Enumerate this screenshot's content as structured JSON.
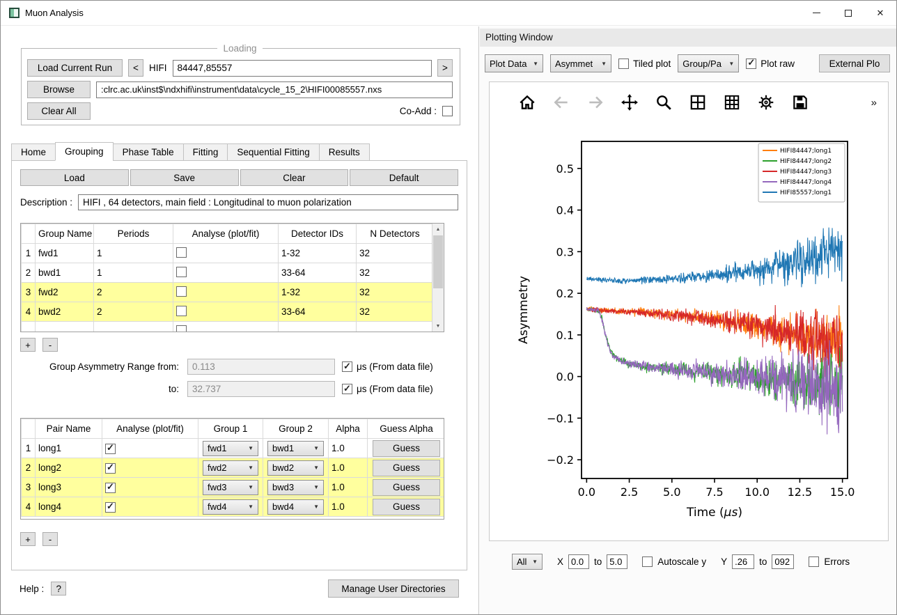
{
  "window": {
    "title": "Muon Analysis",
    "minimize": "",
    "maximize": "",
    "close": "✕"
  },
  "loading": {
    "group_title": "Loading",
    "load_current_run": "Load Current Run",
    "prev_run": "<",
    "next_run": ">",
    "instrument_label": "HIFI",
    "runs_value": "84447,85557",
    "browse": "Browse",
    "file_path": ":clrc.ac.uk\\inst$\\ndxhifi\\instrument\\data\\cycle_15_2\\HIFI00085557.nxs",
    "clear_all": "Clear All",
    "co_add_label": "Co-Add :",
    "co_add_checked": false
  },
  "tabs": [
    {
      "label": "Home"
    },
    {
      "label": "Grouping"
    },
    {
      "label": "Phase Table"
    },
    {
      "label": "Fitting"
    },
    {
      "label": "Sequential Fitting"
    },
    {
      "label": "Results"
    }
  ],
  "active_tab": "Grouping",
  "grouping": {
    "load": "Load",
    "save": "Save",
    "clear": "Clear",
    "default": "Default",
    "description_label": "Description :",
    "description_value": "HIFI , 64 detectors, main field : Longitudinal to muon polarization",
    "group_table": {
      "headers": {
        "name": "Group Name",
        "periods": "Periods",
        "analyse": "Analyse (plot/fit)",
        "detector_ids": "Detector IDs",
        "n_detectors": "N Detectors"
      },
      "rows": [
        {
          "num": "1",
          "name": "fwd1",
          "periods": "1",
          "analyse": false,
          "detector_ids": "1-32",
          "n_detectors": "32",
          "highlight": false
        },
        {
          "num": "2",
          "name": "bwd1",
          "periods": "1",
          "analyse": false,
          "detector_ids": "33-64",
          "n_detectors": "32",
          "highlight": false
        },
        {
          "num": "3",
          "name": "fwd2",
          "periods": "2",
          "analyse": false,
          "detector_ids": "1-32",
          "n_detectors": "32",
          "highlight": true
        },
        {
          "num": "4",
          "name": "bwd2",
          "periods": "2",
          "analyse": false,
          "detector_ids": "33-64",
          "n_detectors": "32",
          "highlight": true
        },
        {
          "num": "",
          "name": "",
          "periods": "",
          "analyse": false,
          "detector_ids": "",
          "n_detectors": "",
          "highlight": false
        }
      ]
    },
    "add_button": "+",
    "remove_button": "-",
    "range": {
      "from_label": "Group Asymmetry Range from:",
      "from_value": "0.113",
      "to_label": "to:",
      "to_value": "32.737",
      "unit_label": "μs (From data file)",
      "from_checked": true,
      "to_checked": true
    },
    "pair_table": {
      "headers": {
        "name": "Pair Name",
        "analyse": "Analyse (plot/fit)",
        "group1": "Group 1",
        "group2": "Group 2",
        "alpha": "Alpha",
        "guess": "Guess Alpha"
      },
      "rows": [
        {
          "num": "1",
          "name": "long1",
          "analyse": true,
          "group1": "fwd1",
          "group2": "bwd1",
          "alpha": "1.0",
          "guess": "Guess",
          "highlight": false
        },
        {
          "num": "2",
          "name": "long2",
          "analyse": true,
          "group1": "fwd2",
          "group2": "bwd2",
          "alpha": "1.0",
          "guess": "Guess",
          "highlight": true
        },
        {
          "num": "3",
          "name": "long3",
          "analyse": true,
          "group1": "fwd3",
          "group2": "bwd3",
          "alpha": "1.0",
          "guess": "Guess",
          "highlight": true
        },
        {
          "num": "4",
          "name": "long4",
          "analyse": true,
          "group1": "fwd4",
          "group2": "bwd4",
          "alpha": "1.0",
          "guess": "Guess",
          "highlight": true
        }
      ]
    },
    "help_label": "Help :",
    "help_button": "?",
    "manage_dirs": "Manage User Directories"
  },
  "plotting": {
    "title": "Plotting Window",
    "toolbar": {
      "plot_data": "Plot Data",
      "plot_type": "Asymmet",
      "tiled_plot": "Tiled plot",
      "tiled_checked": false,
      "group_pair": "Group/Pa",
      "plot_raw": "Plot raw",
      "plot_raw_checked": true,
      "external_plot": "External Plo",
      "overflow": "»"
    },
    "controls": {
      "scope": "All",
      "x_label": "X",
      "x_from": "0.0",
      "to_label": "to",
      "x_to": "5.0",
      "autoscale_label": "Autoscale y",
      "autoscale_checked": false,
      "y_label": "Y",
      "y_from": ".26",
      "y_to": "092",
      "errors_label": "Errors",
      "errors_checked": false
    }
  },
  "chart_data": {
    "type": "line",
    "title": "",
    "xlabel": "Time (μs)",
    "ylabel": "Asymmetry",
    "xlim": [
      -0.3,
      15.3
    ],
    "ylim": [
      -0.245,
      0.565
    ],
    "xticks": [
      0.0,
      2.5,
      5.0,
      7.5,
      10.0,
      12.5,
      15.0
    ],
    "yticks": [
      -0.2,
      -0.1,
      0.0,
      0.1,
      0.2,
      0.3,
      0.4,
      0.5
    ],
    "grid": false,
    "legend_position": "upper right",
    "series": [
      {
        "name": "HIFI84447;long1",
        "color": "#ff7f0e",
        "trend": [
          [
            0,
            0.163
          ],
          [
            1,
            0.16
          ],
          [
            2,
            0.157
          ],
          [
            3,
            0.155
          ],
          [
            4,
            0.152
          ],
          [
            5,
            0.149
          ],
          [
            6,
            0.146
          ],
          [
            7,
            0.141
          ],
          [
            8,
            0.135
          ],
          [
            9,
            0.128
          ],
          [
            10,
            0.12
          ],
          [
            11,
            0.112
          ],
          [
            12,
            0.104
          ],
          [
            13,
            0.096
          ],
          [
            14,
            0.088
          ],
          [
            15,
            0.08
          ]
        ],
        "noise": [
          [
            0,
            0.004
          ],
          [
            4,
            0.008
          ],
          [
            8,
            0.016
          ],
          [
            10,
            0.024
          ],
          [
            12,
            0.038
          ],
          [
            15,
            0.06
          ]
        ]
      },
      {
        "name": "HIFI84447;long2",
        "color": "#2ca02c",
        "trend": [
          [
            0,
            0.162
          ],
          [
            0.7,
            0.158
          ],
          [
            0.9,
            0.14
          ],
          [
            1.1,
            0.1
          ],
          [
            1.4,
            0.062
          ],
          [
            1.8,
            0.042
          ],
          [
            2.5,
            0.03
          ],
          [
            3.5,
            0.023
          ],
          [
            5,
            0.017
          ],
          [
            7,
            0.011
          ],
          [
            9,
            0.005
          ],
          [
            11,
            -0.003
          ],
          [
            13,
            -0.011
          ],
          [
            15,
            -0.02
          ]
        ],
        "noise": [
          [
            0,
            0.004
          ],
          [
            3,
            0.008
          ],
          [
            6,
            0.015
          ],
          [
            9,
            0.026
          ],
          [
            12,
            0.045
          ],
          [
            15,
            0.08
          ]
        ]
      },
      {
        "name": "HIFI84447;long3",
        "color": "#d62728",
        "trend": [
          [
            0,
            0.162
          ],
          [
            1,
            0.159
          ],
          [
            2,
            0.156
          ],
          [
            3,
            0.154
          ],
          [
            4,
            0.151
          ],
          [
            5,
            0.148
          ],
          [
            6,
            0.144
          ],
          [
            7,
            0.139
          ],
          [
            8,
            0.133
          ],
          [
            9,
            0.126
          ],
          [
            10,
            0.118
          ],
          [
            11,
            0.11
          ],
          [
            12,
            0.101
          ],
          [
            13,
            0.091
          ],
          [
            14,
            0.081
          ],
          [
            15,
            0.071
          ]
        ],
        "noise": [
          [
            0,
            0.004
          ],
          [
            4,
            0.008
          ],
          [
            8,
            0.018
          ],
          [
            10,
            0.027
          ],
          [
            12,
            0.042
          ],
          [
            15,
            0.065
          ]
        ]
      },
      {
        "name": "HIFI84447;long4",
        "color": "#9467bd",
        "trend": [
          [
            0,
            0.162
          ],
          [
            0.7,
            0.158
          ],
          [
            0.95,
            0.13
          ],
          [
            1.2,
            0.082
          ],
          [
            1.5,
            0.052
          ],
          [
            2,
            0.036
          ],
          [
            3,
            0.027
          ],
          [
            4.5,
            0.02
          ],
          [
            6,
            0.014
          ],
          [
            8,
            0.007
          ],
          [
            10,
            0.0
          ],
          [
            12,
            -0.01
          ],
          [
            14,
            -0.022
          ],
          [
            15,
            -0.03
          ]
        ],
        "noise": [
          [
            0,
            0.004
          ],
          [
            3,
            0.008
          ],
          [
            6,
            0.016
          ],
          [
            9,
            0.028
          ],
          [
            12,
            0.05
          ],
          [
            14,
            0.075
          ],
          [
            15,
            0.09
          ]
        ]
      },
      {
        "name": "HIFI85557;long1",
        "color": "#1f77b4",
        "trend": [
          [
            0,
            0.235
          ],
          [
            1,
            0.232
          ],
          [
            2,
            0.23
          ],
          [
            3,
            0.231
          ],
          [
            4,
            0.233
          ],
          [
            5,
            0.235
          ],
          [
            6,
            0.238
          ],
          [
            7,
            0.241
          ],
          [
            8,
            0.245
          ],
          [
            9,
            0.25
          ],
          [
            10,
            0.257
          ],
          [
            11,
            0.265
          ],
          [
            12,
            0.273
          ],
          [
            13,
            0.282
          ],
          [
            14,
            0.292
          ],
          [
            15,
            0.3
          ]
        ],
        "noise": [
          [
            0,
            0.004
          ],
          [
            4,
            0.007
          ],
          [
            8,
            0.014
          ],
          [
            10,
            0.024
          ],
          [
            12,
            0.038
          ],
          [
            15,
            0.055
          ]
        ]
      }
    ]
  }
}
